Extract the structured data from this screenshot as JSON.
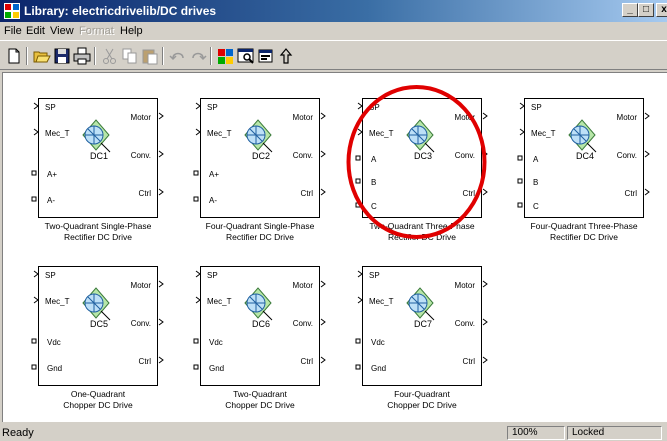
{
  "window": {
    "title": "Library: electricdrivelib/DC drives",
    "min_label": "_",
    "max_label": "□",
    "close_label": "x"
  },
  "menu": [
    {
      "label": "File",
      "enabled": true
    },
    {
      "label": "Edit",
      "enabled": true
    },
    {
      "label": "View",
      "enabled": true
    },
    {
      "label": "Format",
      "enabled": false
    },
    {
      "label": "Help",
      "enabled": true
    }
  ],
  "toolbar": {
    "buttons": [
      "new-icon",
      "open-icon",
      "save-icon",
      "print-icon",
      "cut-icon",
      "copy-icon",
      "paste-icon",
      "undo-icon",
      "redo-icon",
      "library-browser-icon",
      "model-explorer-icon",
      "debugger-icon",
      "go-to-parent-icon"
    ]
  },
  "blocks": [
    {
      "name": "DC1",
      "ports_left": [
        "SP",
        "Mec_T",
        "A+",
        "A-"
      ],
      "ports_right": [
        "Motor",
        "Conv.",
        "Ctrl"
      ],
      "caption": [
        "Two-Quadrant Single-Phase",
        "Rectifier DC Drive"
      ]
    },
    {
      "name": "DC2",
      "ports_left": [
        "SP",
        "Mec_T",
        "A+",
        "A-"
      ],
      "ports_right": [
        "Motor",
        "Conv.",
        "Ctrl"
      ],
      "caption": [
        "Four-Quadrant Single-Phase",
        "Rectifier DC Drive"
      ]
    },
    {
      "name": "DC3",
      "ports_left": [
        "SP",
        "Mec_T",
        "A",
        "B",
        "C"
      ],
      "ports_right": [
        "Motor",
        "Conv.",
        "Ctrl"
      ],
      "caption": [
        "Two-Quadrant Three-Phase",
        "Rectifier DC Drive"
      ]
    },
    {
      "name": "DC4",
      "ports_left": [
        "SP",
        "Mec_T",
        "A",
        "B",
        "C"
      ],
      "ports_right": [
        "Motor",
        "Conv.",
        "Ctrl"
      ],
      "caption": [
        "Four-Quadrant Three-Phase",
        "Rectifier DC Drive"
      ]
    },
    {
      "name": "DC5",
      "ports_left": [
        "SP",
        "Mec_T",
        "Vdc",
        "Gnd"
      ],
      "ports_right": [
        "Motor",
        "Conv.",
        "Ctrl"
      ],
      "caption": [
        "One-Quadrant",
        "Chopper DC Drive"
      ]
    },
    {
      "name": "DC6",
      "ports_left": [
        "SP",
        "Mec_T",
        "Vdc",
        "Gnd"
      ],
      "ports_right": [
        "Motor",
        "Conv.",
        "Ctrl"
      ],
      "caption": [
        "Two-Quadrant",
        "Chopper DC Drive"
      ]
    },
    {
      "name": "DC7",
      "ports_left": [
        "SP",
        "Mec_T",
        "Vdc",
        "Gnd"
      ],
      "ports_right": [
        "Motor",
        "Conv.",
        "Ctrl"
      ],
      "caption": [
        "Four-Quadrant",
        "Chopper DC Drive"
      ]
    }
  ],
  "highlight": {
    "color": "#e00000",
    "target": "DC3"
  },
  "status": {
    "text": "Ready",
    "zoom": "100%",
    "lock": "Locked"
  }
}
